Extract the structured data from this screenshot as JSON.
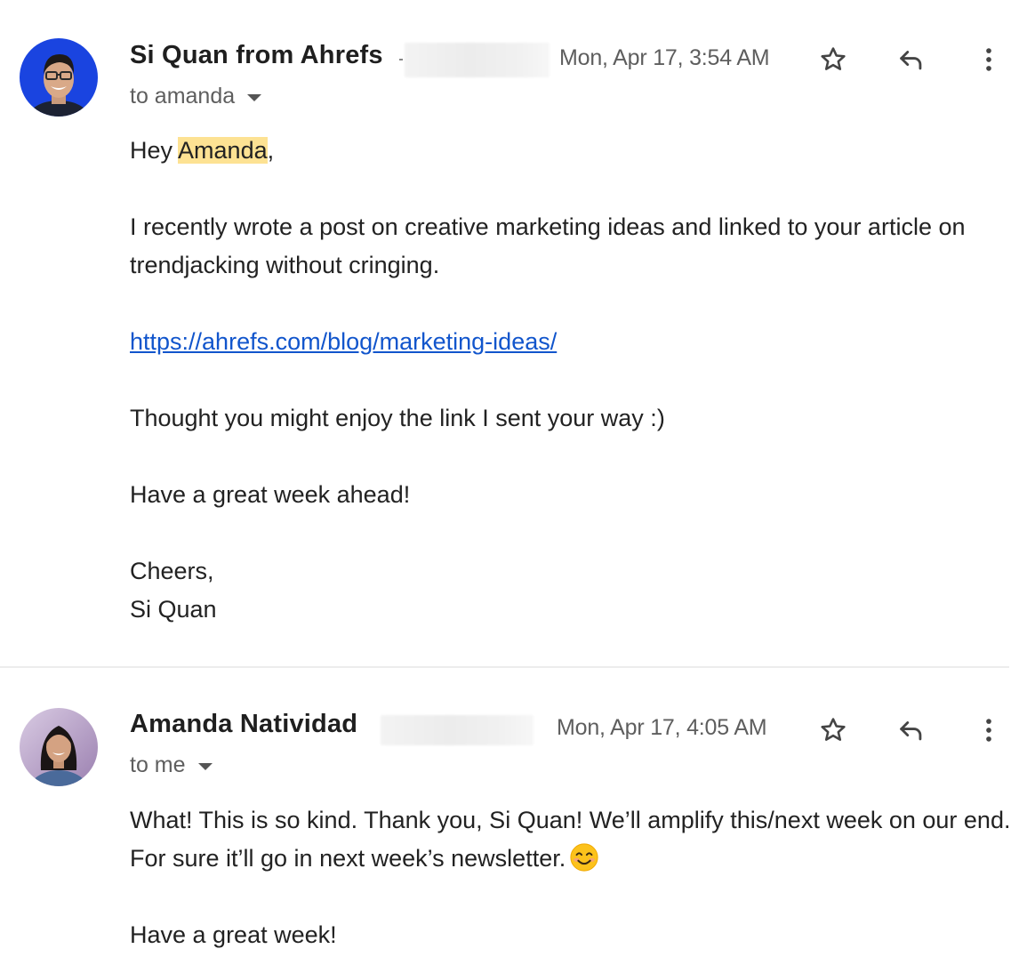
{
  "messages": [
    {
      "sender_name": "Si Quan from Ahrefs",
      "sender_email_redacted": true,
      "timestamp": "Mon, Apr 17, 3:54 AM",
      "recipient_label": "to amanda",
      "avatar": {
        "description": "Si Quan profile photo",
        "background_color": "#1a44e0"
      },
      "actions": {
        "star": "star-icon",
        "reply": "reply-icon",
        "more": "more-vert-icon"
      },
      "body": {
        "greeting_prefix": "Hey ",
        "greeting_name": "Amanda",
        "greeting_suffix": ",",
        "paragraph_1": "I recently wrote a post on creative marketing ideas and linked to your article on trendjacking without cringing.",
        "link": "https://ahrefs.com/blog/marketing-ideas/",
        "paragraph_2": "Thought you might enjoy the link I sent your way :)",
        "paragraph_3": "Have a great week ahead!",
        "signoff": "Cheers,",
        "signature": "Si Quan"
      }
    },
    {
      "sender_name": "Amanda Natividad",
      "sender_email_redacted": true,
      "timestamp": "Mon, Apr 17, 4:05 AM",
      "recipient_label": "to me",
      "avatar": {
        "description": "Amanda Natividad profile photo",
        "background_color": "#b39dc4"
      },
      "actions": {
        "star": "star-icon",
        "reply": "reply-icon",
        "more": "more-vert-icon"
      },
      "body": {
        "paragraph_1": "What! This is so kind. Thank you, Si Quan! We’ll amplify this/next week on our end. For sure it’ll go in next week’s newsletter.",
        "emoji": "smiling-face-with-smiling-eyes",
        "paragraph_2": "Have a great week!"
      }
    }
  ],
  "colors": {
    "link": "#1155cc",
    "highlight": "#fde293",
    "secondary_text": "#5e5e5e",
    "divider": "#ececec"
  }
}
